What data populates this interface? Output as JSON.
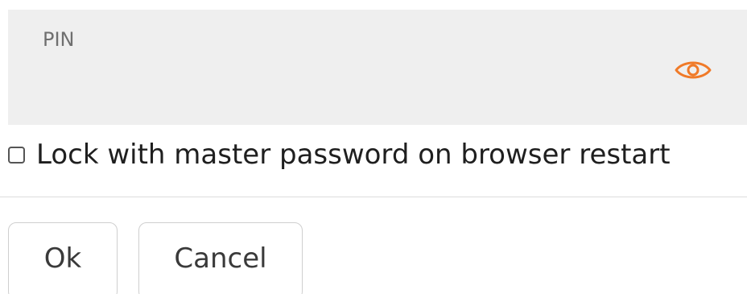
{
  "pin_field": {
    "label": "PIN",
    "value": "",
    "toggle_icon": "eye-icon",
    "accent_color": "#f07a28"
  },
  "lock_option": {
    "label": "Lock with master password on browser restart",
    "checked": false
  },
  "actions": {
    "ok_label": "Ok",
    "cancel_label": "Cancel"
  }
}
